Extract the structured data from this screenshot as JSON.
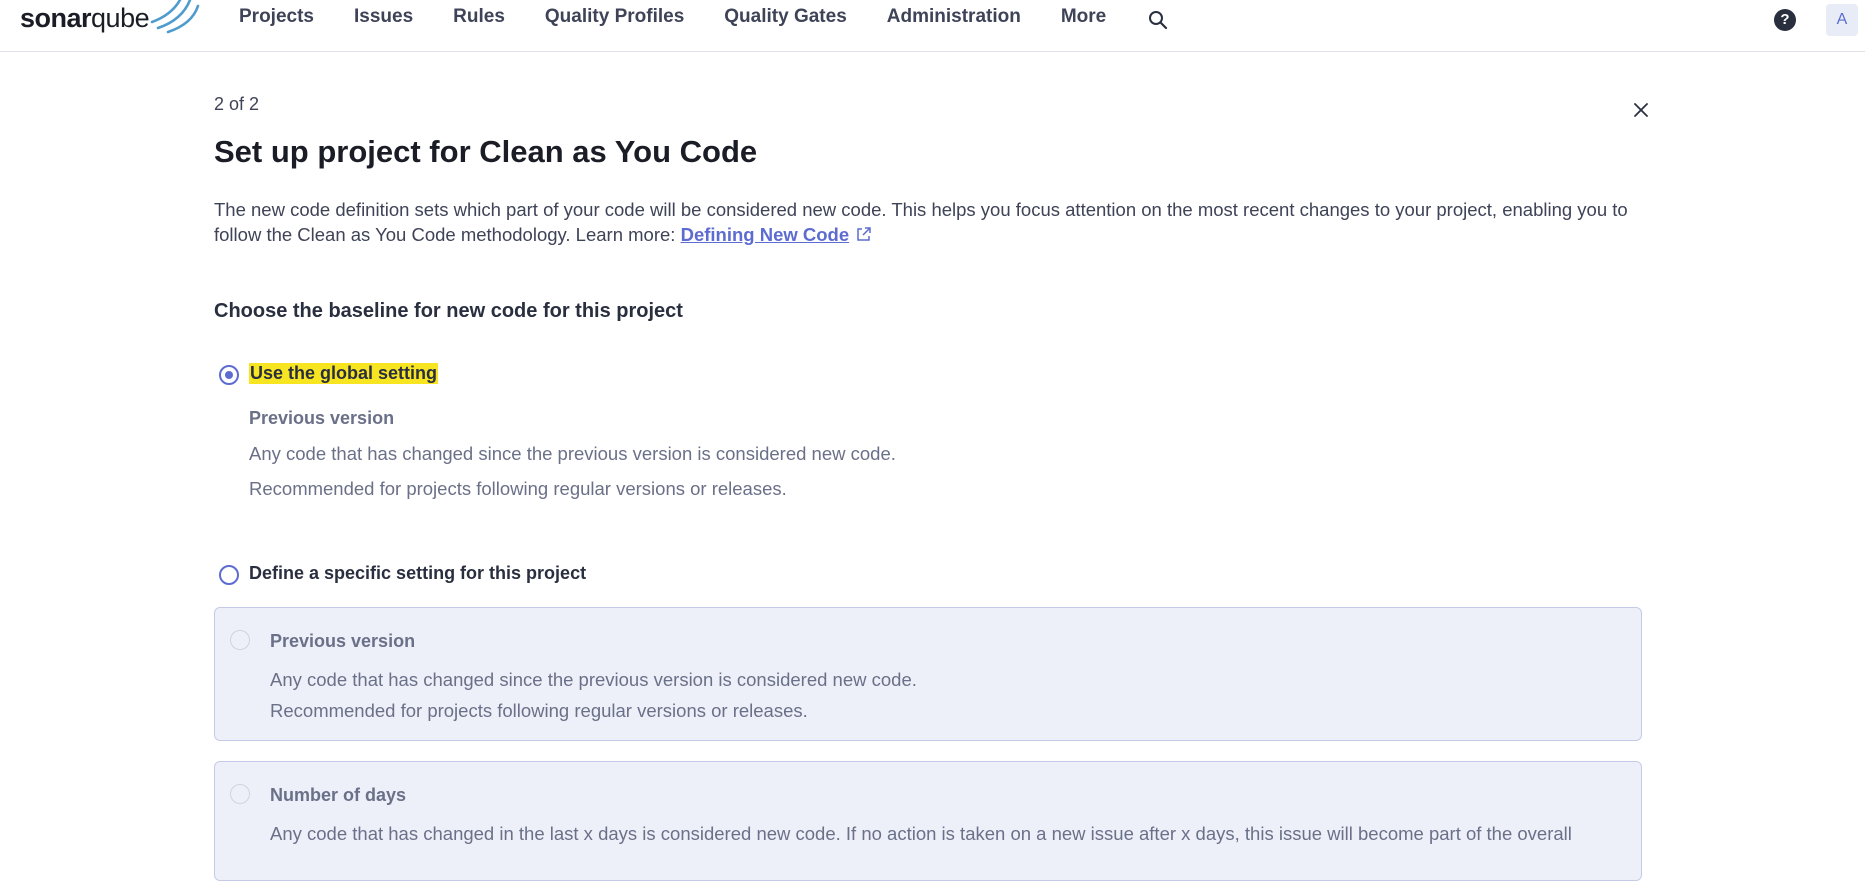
{
  "header": {
    "logo_bold": "sonar",
    "logo_thin": "qube",
    "nav": [
      "Projects",
      "Issues",
      "Rules",
      "Quality Profiles",
      "Quality Gates",
      "Administration",
      "More"
    ],
    "avatar_initial": "A",
    "help_symbol": "?",
    "icons": {
      "search": "search-icon",
      "help": "help-icon",
      "logo": "sonarqube-logo"
    }
  },
  "modal": {
    "step": "2 of 2",
    "title": "Set up project for Clean as You Code",
    "description": "The new code definition sets which part of your code will be considered new code. This helps you focus attention on the most recent changes to your project, enabling you to follow the Clean as You Code methodology. Learn more: ",
    "learn_more_link": "Defining New Code",
    "section_heading": "Choose the baseline for new code for this project",
    "options": {
      "global": {
        "label": "Use the global setting",
        "checked": true,
        "highlight_color": "#f7e521",
        "sub_title": "Previous version",
        "sub_line1": "Any code that has changed since the previous version is considered new code.",
        "sub_line2": "Recommended for projects following regular versions or releases."
      },
      "specific": {
        "label": "Define a specific setting for this project",
        "checked": false
      }
    },
    "cards": [
      {
        "title": "Previous version",
        "line1": "Any code that has changed since the previous version is considered new code.",
        "line2": "Recommended for projects following regular versions or releases."
      },
      {
        "title": "Number of days",
        "line1": "Any code that has changed in the last x days is considered new code. If no action is taken on a new issue after x days, this issue will become part of the overall"
      }
    ]
  },
  "colors": {
    "accent": "#5d6cd0",
    "text_dark": "#1b1d26",
    "text_muted": "#6a7088",
    "card_bg": "#eef0f9",
    "card_border": "#c5cbe6"
  }
}
